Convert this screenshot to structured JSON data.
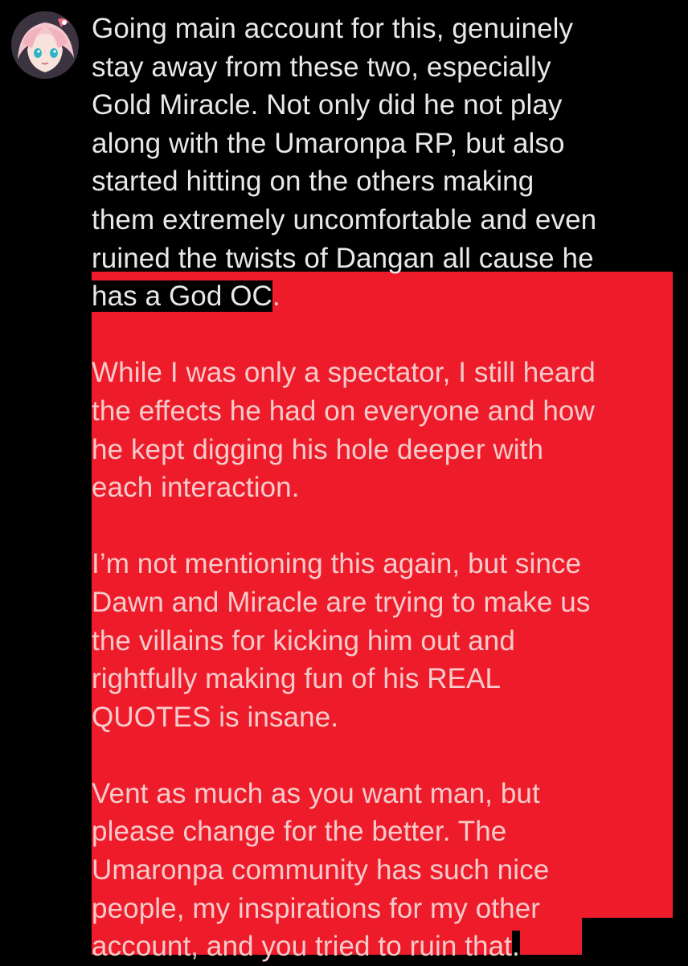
{
  "colors": {
    "background": "#000000",
    "text": "#e8e8e8",
    "highlight": "#ee1c2b",
    "highlighted_text": "#f6cbcb"
  },
  "avatar": {
    "icon": "anime-avatar-icon"
  },
  "post": {
    "intro_lines": [
      "Going main account for this, genuinely",
      "stay away from these two, especially",
      "Gold Miracle. Not only did he not play",
      "along with the Umaronpa RP, but also",
      "started hitting on the others making",
      "them extremely uncomfortable and even",
      "ruined the twists of Dangan all cause he",
      "has a God OC",
      "."
    ],
    "paragraph_2": [
      "While I was only a spectator, I still heard",
      "the effects he had on everyone and how",
      "he kept digging his hole deeper with",
      "each interaction."
    ],
    "paragraph_3": [
      "I’m not mentioning this again, but since",
      "Dawn and Miracle are trying to make us",
      "the villains for kicking him out and",
      "rightfully making fun of his REAL",
      "QUOTES is insane."
    ],
    "paragraph_4": [
      "Vent as much as you want man, but",
      "please change for the better. The",
      "Umaronpa community has such nice",
      "people, my inspirations for my other",
      "account, and you tried to ruin that",
      "."
    ]
  }
}
